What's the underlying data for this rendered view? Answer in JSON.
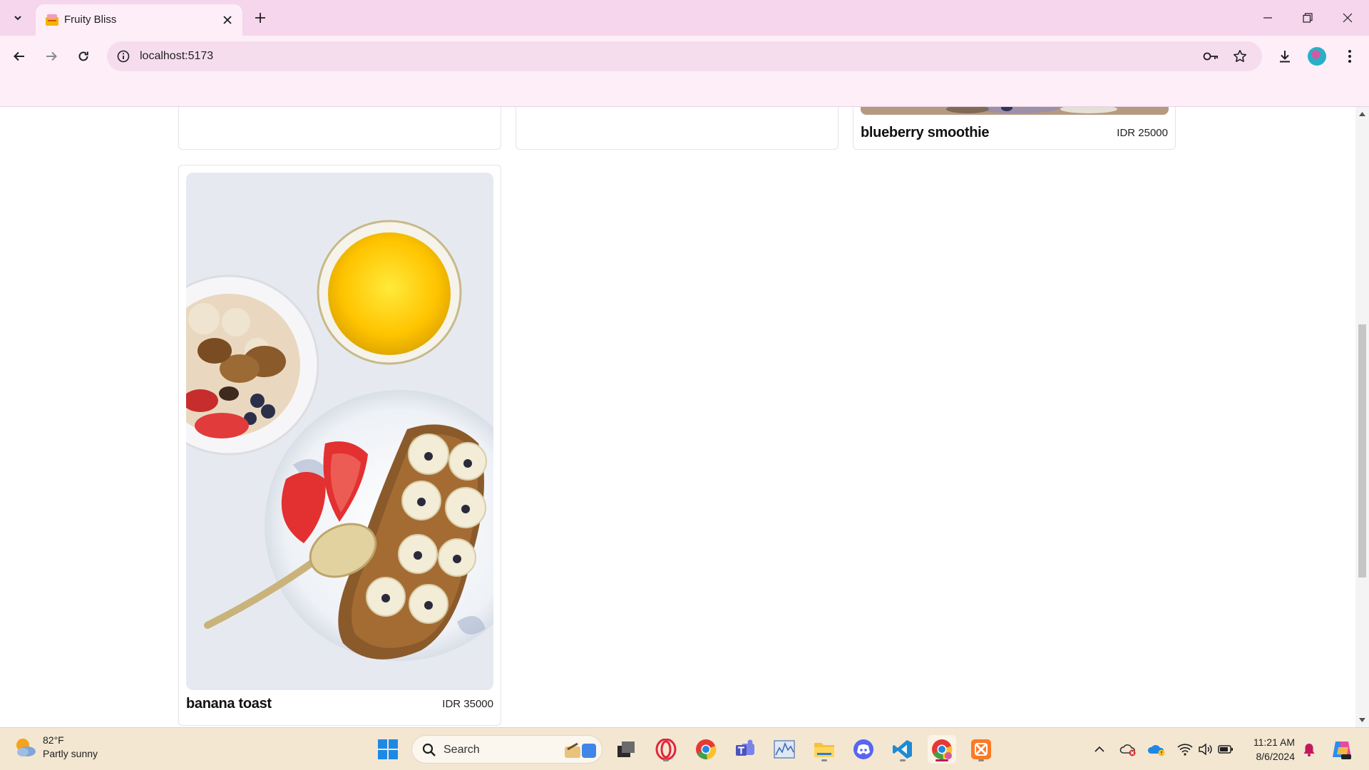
{
  "browser": {
    "tab_title": "Fruity Bliss",
    "url": "localhost:5173"
  },
  "page": {
    "products": [
      {
        "name": "blueberry smoothie",
        "price": "IDR 25000"
      },
      {
        "name": "banana toast",
        "price": "IDR 35000"
      }
    ]
  },
  "taskbar": {
    "weather_temp": "82°F",
    "weather_desc": "Partly sunny",
    "search_label": "Search",
    "time": "11:21 AM",
    "date": "8/6/2024"
  },
  "colors": {
    "chrome_bg": "#f6d6ec",
    "toolbar_bg": "#fdeef8",
    "taskbar_bg": "#f3e7d2",
    "accent": "#c2185b"
  }
}
